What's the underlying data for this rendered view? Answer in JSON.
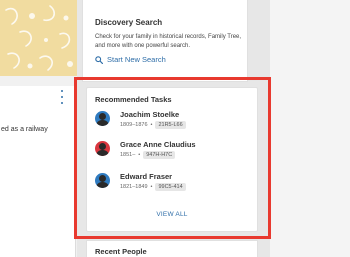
{
  "discovery": {
    "title": "Discovery Search",
    "description": "Check for your family in historical records, Family Tree, and more with one powerful search.",
    "link_label": "Start New Search",
    "link_icon": "search-icon"
  },
  "left_snippet": "ed as a railway",
  "tasks": {
    "title": "Recommended Tasks",
    "people": [
      {
        "name": "Joachim Stoelke",
        "dates": "1809–1876",
        "separator": "•",
        "pid": "21R5-L66",
        "avatar_color": "#2f7bc0"
      },
      {
        "name": "Grace Anne Claudius",
        "dates": "1851–",
        "separator": "•",
        "pid": "947H-H7C",
        "avatar_color": "#d9363e"
      },
      {
        "name": "Edward Fraser",
        "dates": "1821–1849",
        "separator": "•",
        "pid": "99C5-414",
        "avatar_color": "#2f7bc0"
      }
    ],
    "view_all": "VIEW ALL"
  },
  "recent": {
    "title": "Recent People"
  },
  "colors": {
    "highlight": "#e8392f",
    "link": "#2f6ea8",
    "banner": "#f1dca0"
  }
}
